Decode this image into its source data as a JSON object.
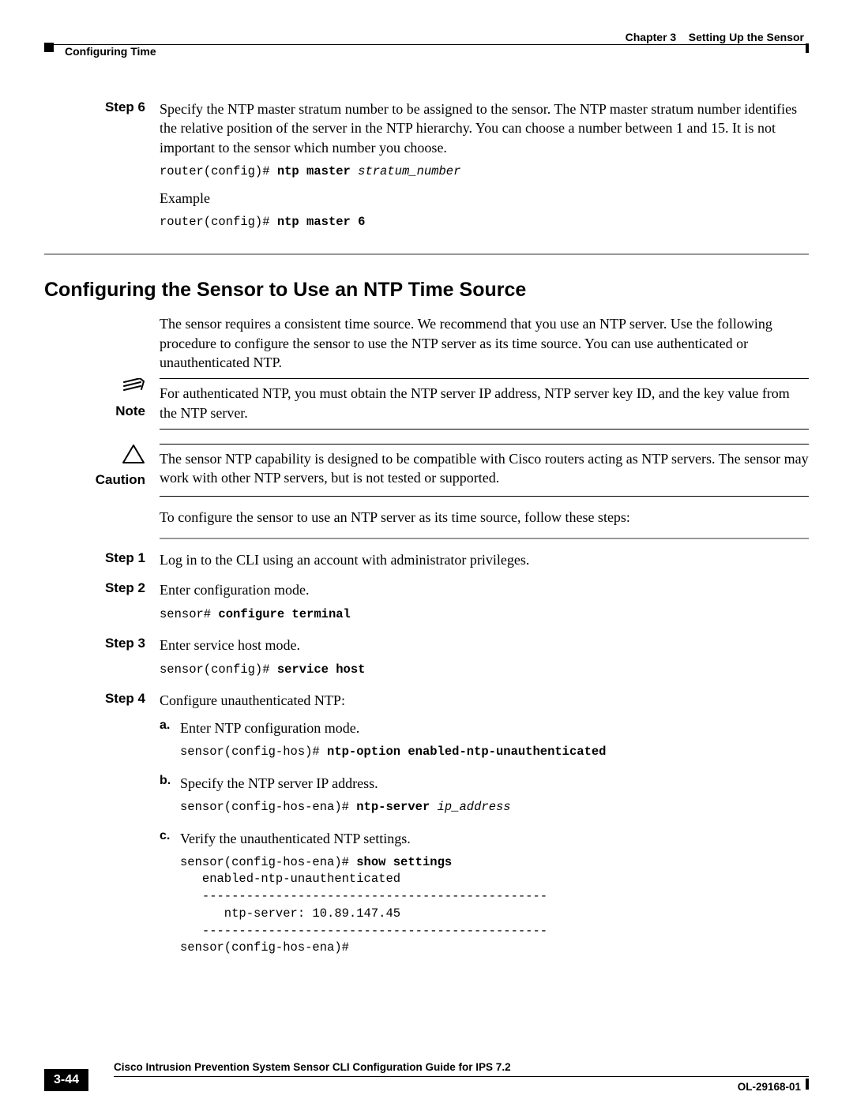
{
  "header": {
    "chapter_label": "Chapter 3",
    "chapter_title": "Setting Up the Sensor",
    "section_breadcrumb": "Configuring Time"
  },
  "step6": {
    "label": "Step 6",
    "text": "Specify the NTP master stratum number to be assigned to the sensor. The NTP master stratum number identifies the relative position of the server in the NTP hierarchy. You can choose a number between 1 and 15. It is not important to the sensor which number you choose.",
    "cmd_prompt": "router(config)# ",
    "cmd_bold": "ntp master ",
    "cmd_arg": "stratum_number",
    "example_label": "Example",
    "ex_prompt": "router(config)# ",
    "ex_bold": "ntp master 6"
  },
  "section_title": "Configuring the Sensor to Use an NTP Time Source",
  "intro_text": "The sensor requires a consistent time source. We recommend that you use an NTP server. Use the following procedure to configure the sensor to use the NTP server as its time source. You can use authenticated or unauthenticated NTP.",
  "note": {
    "label": "Note",
    "text": "For authenticated NTP, you must obtain the NTP server IP address, NTP server key ID, and the key value from the NTP server."
  },
  "caution": {
    "label": "Caution",
    "text": "The sensor NTP capability is designed to be compatible with Cisco routers acting as NTP servers. The sensor may work with other NTP servers, but is not tested or supported."
  },
  "lead_in": "To configure the sensor to use an NTP server as its time source, follow these steps:",
  "steps": {
    "s1": {
      "label": "Step 1",
      "text": "Log in to the CLI using an account with administrator privileges."
    },
    "s2": {
      "label": "Step 2",
      "text": "Enter configuration mode.",
      "cmd_prompt": "sensor# ",
      "cmd_bold": "configure terminal"
    },
    "s3": {
      "label": "Step 3",
      "text": "Enter service host mode.",
      "cmd_prompt": "sensor(config)# ",
      "cmd_bold": "service host"
    },
    "s4": {
      "label": "Step 4",
      "text": "Configure unauthenticated NTP:",
      "a": {
        "label": "a.",
        "text": "Enter NTP configuration mode.",
        "cmd_prompt": "sensor(config-hos)# ",
        "cmd_bold": "ntp-option enabled-ntp-unauthenticated"
      },
      "b": {
        "label": "b.",
        "text": "Specify the NTP server IP address.",
        "cmd_prompt": "sensor(config-hos-ena)# ",
        "cmd_bold": "ntp-server ",
        "cmd_arg": "ip_address"
      },
      "c": {
        "label": "c.",
        "text": "Verify the unauthenticated NTP settings.",
        "cmd_prompt1": "sensor(config-hos-ena)# ",
        "cmd_bold1": "show settings",
        "out1": "   enabled-ntp-unauthenticated",
        "out2": "   -----------------------------------------------",
        "out3": "      ntp-server: 10.89.147.45",
        "out4": "   -----------------------------------------------",
        "out5": "sensor(config-hos-ena)#"
      }
    }
  },
  "footer": {
    "guide": "Cisco Intrusion Prevention System Sensor CLI Configuration Guide for IPS 7.2",
    "page": "3-44",
    "docnum": "OL-29168-01"
  }
}
